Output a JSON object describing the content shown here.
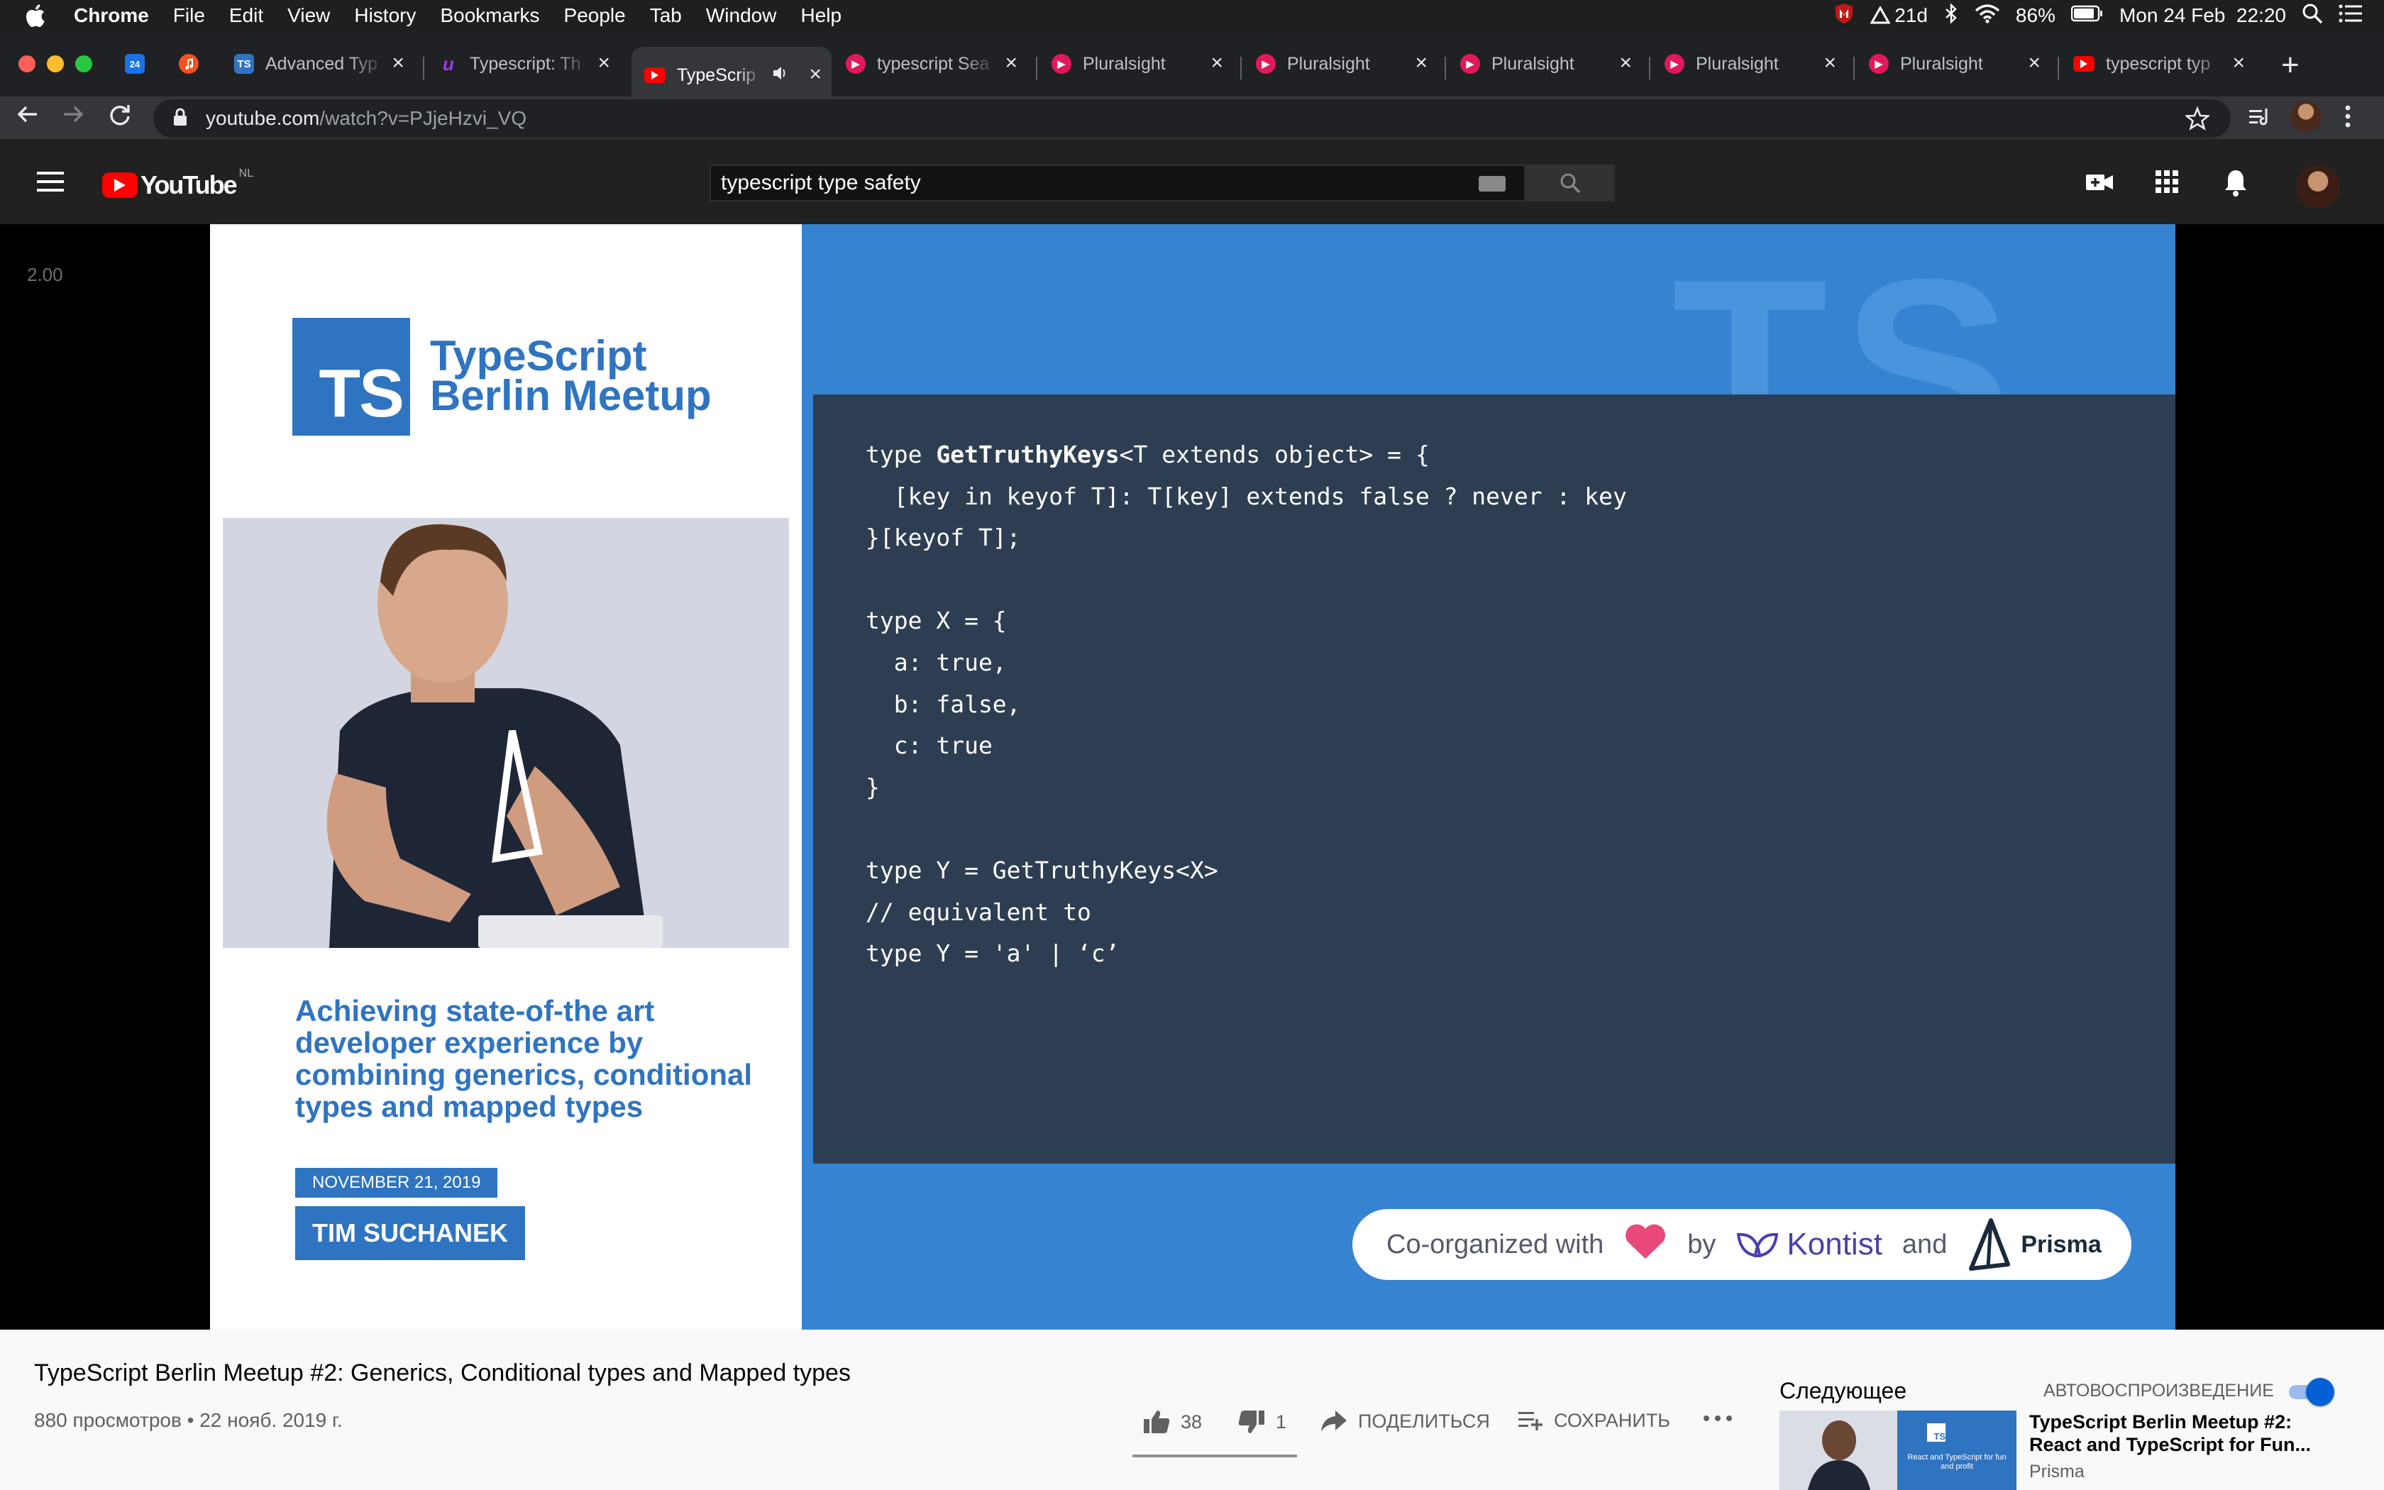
{
  "menubar": {
    "app": "Chrome",
    "items": [
      "File",
      "Edit",
      "View",
      "History",
      "Bookmarks",
      "People",
      "Tab",
      "Window",
      "Help"
    ],
    "status": {
      "timer": "21d",
      "battery": "86%",
      "clock": "Mon 24 Feb  22:20"
    }
  },
  "tabs": [
    {
      "title": "",
      "favicon": "calendar-icon",
      "favicon_text": "24",
      "color": "#1a73e8"
    },
    {
      "title": "",
      "favicon": "music-icon",
      "color": "#f4511e"
    },
    {
      "title": "Advanced Typ",
      "favicon": "ts-icon",
      "favicon_text": "TS",
      "color": "#2f74c0"
    },
    {
      "title": "Typescript: Th",
      "favicon": "udemy-icon",
      "color": "#a435f0"
    },
    {
      "title": "TypeScrip",
      "favicon": "youtube-icon",
      "color": "#ff0000",
      "active": true
    },
    {
      "title": "typescript Sea",
      "favicon": "pluralsight-icon",
      "color": "#e0195a"
    },
    {
      "title": "Pluralsight",
      "favicon": "pluralsight-icon",
      "color": "#e0195a"
    },
    {
      "title": "Pluralsight",
      "favicon": "pluralsight-icon",
      "color": "#e0195a"
    },
    {
      "title": "Pluralsight",
      "favicon": "pluralsight-icon",
      "color": "#e0195a"
    },
    {
      "title": "Pluralsight",
      "favicon": "pluralsight-icon",
      "color": "#e0195a"
    },
    {
      "title": "Pluralsight",
      "favicon": "pluralsight-icon",
      "color": "#e0195a"
    },
    {
      "title": "typescript typ",
      "favicon": "youtube-icon",
      "color": "#ff0000"
    }
  ],
  "toolbar": {
    "url_host": "youtube.com",
    "url_path": "/watch?v=PJjeHzvi_VQ"
  },
  "youtube": {
    "logo_text": "YouTube",
    "region": "NL",
    "search_value": "typescript type safety"
  },
  "player": {
    "speed_overlay": "2.00",
    "slide": {
      "logo_text": "TS",
      "event_line1": "TypeScript",
      "event_line2": "Berlin Meetup",
      "talk_title": "Achieving state-of-the art developer experience by combining generics, conditional types and mapped types",
      "date": "NOVEMBER 21, 2019",
      "speaker": "TIM SUCHANEK",
      "bg_letters": "TS",
      "code_lines": [
        "type GetTruthyKeys<T extends object> = {",
        "  [key in keyof T]: T[key] extends false ? never : key",
        "}[keyof T];",
        "",
        "type X = {",
        "  a: true,",
        "  b: false,",
        "  c: true",
        "}",
        "",
        "type Y = GetTruthyKeys<X>",
        "// equivalent to",
        "type Y = 'a' | ‘c’"
      ],
      "sponsor": {
        "lead": "Co-organized with",
        "by": "by",
        "kontist": "Kontist",
        "and": "and",
        "prisma": "Prisma"
      }
    }
  },
  "video": {
    "title": "TypeScript Berlin Meetup #2: Generics, Conditional types and Mapped types",
    "views": "880 просмотров",
    "separator": "•",
    "date": "22 нояб. 2019 г.",
    "likes": "38",
    "dislikes": "1",
    "like_ratio": 0.974,
    "share_label": "ПОДЕЛИТЬСЯ",
    "save_label": "СОХРАНИТЬ"
  },
  "sidebar": {
    "next_label": "Следующее",
    "autoplay_label": "АВТОВОСПРОИЗВЕДЕНИЕ",
    "autoplay_on": true,
    "recommendation": {
      "title": "TypeScript Berlin Meetup #2: React and TypeScript for Fun...",
      "channel": "Prisma",
      "thumb_caption": "React and TypeScript for fun and profit",
      "thumb_logo": "TS"
    }
  }
}
